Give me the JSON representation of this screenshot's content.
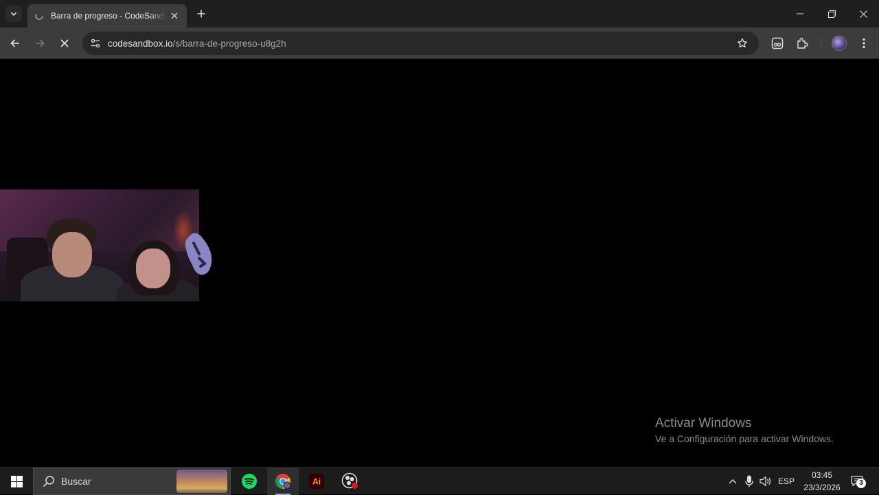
{
  "browser": {
    "tab": {
      "title": "Barra de progreso - CodeSandbox"
    },
    "address_bar": {
      "host": "codesandbox.io",
      "path": "/s/barra-de-progreso-u8g2h"
    }
  },
  "watermark": {
    "line1": "Activar Windows",
    "line2": "Ve a Configuración para activar Windows."
  },
  "taskbar": {
    "search_placeholder": "Buscar",
    "apps": [
      "spotify-icon",
      "chrome-icon",
      "illustrator-icon",
      "obs-icon"
    ],
    "illustrator_label": "Ai",
    "language": "ESP",
    "time": "03:45",
    "date": "23/3/2026",
    "notification_count": "3"
  }
}
